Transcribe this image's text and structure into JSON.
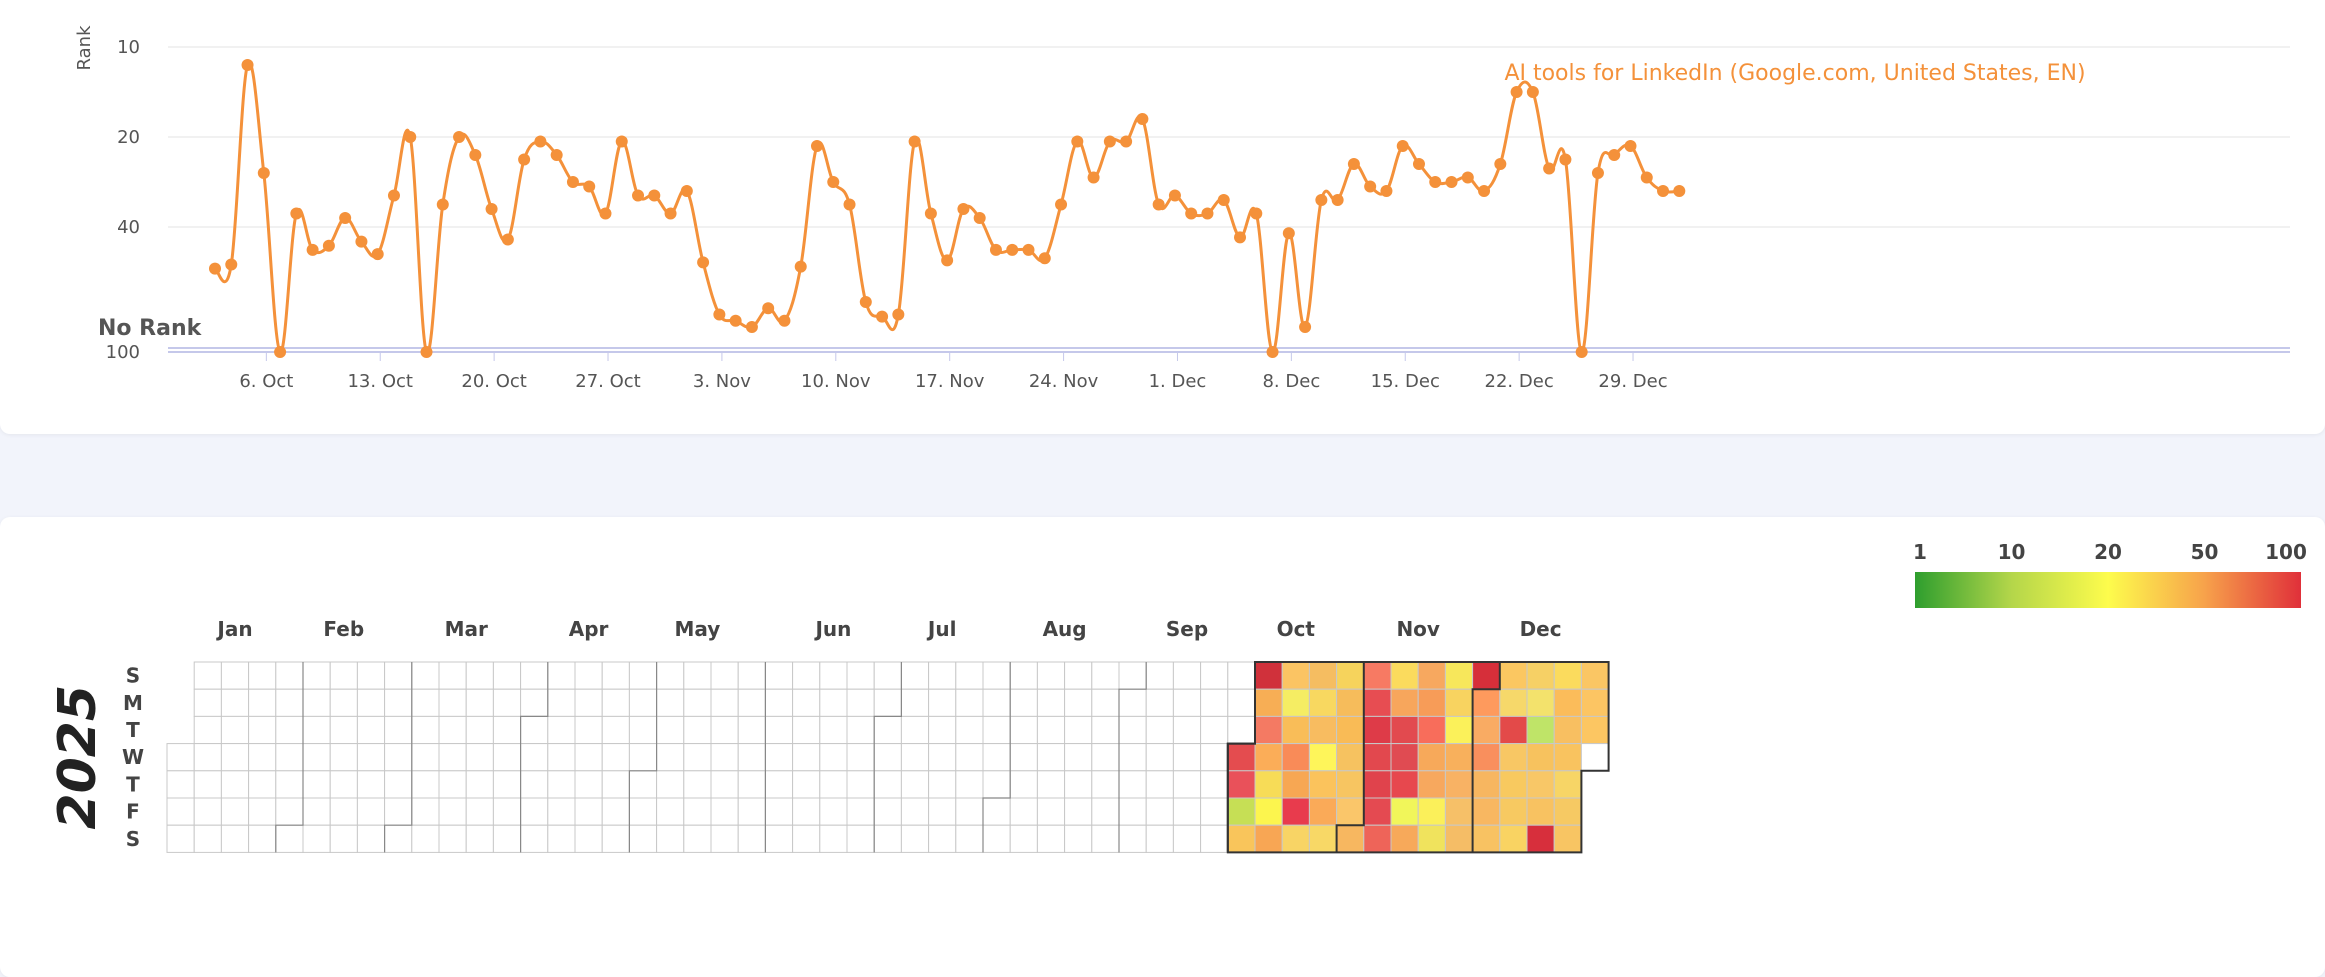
{
  "chart_data": [
    {
      "type": "line",
      "ylabel": "Rank",
      "y_ticks": [
        "10",
        "20",
        "40",
        "100"
      ],
      "y_axis_reversed": true,
      "no_rank_label": "No Rank",
      "x_ticks": [
        "6. Oct",
        "13. Oct",
        "20. Oct",
        "27. Oct",
        "3. Nov",
        "10. Nov",
        "17. Nov",
        "24. Nov",
        "1. Dec",
        "8. Dec",
        "15. Dec",
        "22. Dec",
        "29. Dec"
      ],
      "series": [
        {
          "name": "AI tools for LinkedIn (Google.com, United States, EN)",
          "color": "#f4913a",
          "start_date": "2025-10-01",
          "values": [
            60,
            58,
            12,
            28,
            100,
            37,
            51,
            49,
            38,
            47,
            53,
            33,
            20,
            100,
            35,
            20,
            24,
            36,
            46,
            25,
            21,
            24,
            30,
            31,
            37,
            21,
            33,
            33,
            37,
            32,
            57,
            82,
            85,
            88,
            79,
            85,
            59,
            22,
            30,
            35,
            76,
            83,
            82,
            21,
            37,
            56,
            36,
            38,
            51,
            51,
            51,
            55,
            35,
            21,
            29,
            21,
            21,
            18,
            35,
            33,
            37,
            37,
            34,
            45,
            37,
            100,
            43,
            88,
            34,
            34,
            26,
            31,
            32,
            22,
            26,
            30,
            30,
            29,
            32,
            26,
            15,
            15,
            27,
            25,
            100,
            28,
            24,
            22,
            29,
            32,
            32
          ],
          "null_values_plotted_as": "No Rank"
        }
      ]
    },
    {
      "type": "heatmap",
      "year": "2025",
      "months": [
        "Jan",
        "Feb",
        "Mar",
        "Apr",
        "May",
        "Jun",
        "Jul",
        "Aug",
        "Sep",
        "Oct",
        "Nov",
        "Dec"
      ],
      "weekdays": [
        "S",
        "M",
        "T",
        "W",
        "T",
        "F",
        "S"
      ],
      "color_scale": {
        "labels": [
          "1",
          "10",
          "20",
          "50",
          "100"
        ],
        "colors": [
          "#2e9e2e",
          "#b4d64a",
          "#fdfc4c",
          "#f7a24b",
          "#e0303a"
        ]
      },
      "first_ranked_date": "2025-10-01",
      "daily_colors": [
        "#e44c4f",
        "#e9515a",
        "#c6df55",
        "#f9c55b",
        "#d0313b",
        "#f7ae55",
        "#f47a63",
        "#fbad58",
        "#f7dc57",
        "#fcf54e",
        "#f8a654",
        "#fbc463",
        "#f5ed63",
        "#f9bd58",
        "#f98b58",
        "#f7a753",
        "#e83b4d",
        "#f8d465",
        "#f5bd61",
        "#f8d860",
        "#f8bc60",
        "#fef55a",
        "#fbc35c",
        "#faaa58",
        "#f8d866",
        "#f6d35c",
        "#f6bc5b",
        "#f9bb56",
        "#f6c260",
        "#f7c561",
        "#fac66a",
        "#f7b760",
        "#f77a63",
        "#e74d52",
        "#de3b48",
        "#e2484e",
        "#e0434c",
        "#e44a51",
        "#ee6459",
        "#fbdb5d",
        "#f7a65c",
        "#e24a4f",
        "#e04b52",
        "#e7484e",
        "#f1f65a",
        "#f7a95a",
        "#f7a85f",
        "#f79c58",
        "#f86d5b",
        "#f7a95a",
        "#f7a85e",
        "#fbf05a",
        "#f0e35d",
        "#f7e75b",
        "#f8d360",
        "#fbf15a",
        "#f8b05c",
        "#f8b264",
        "#f6c068",
        "#f5bd66",
        "#d62f3a",
        "#fe9a5d",
        "#f9ab63",
        "#f98f5d",
        "#f7b660",
        "#f8b761",
        "#f8c262",
        "#fbc761",
        "#f6d86a",
        "#e34a49",
        "#f8c764",
        "#f8c95f",
        "#f7c961",
        "#f9d362",
        "#f6d065",
        "#f3e26c",
        "#bfe468",
        "#f7c25e",
        "#f8c767",
        "#f8c261",
        "#d72f3c",
        "#fbdb5d",
        "#fbbc5a",
        "#f8bf61",
        "#f9c35f",
        "#f7d566",
        "#f6c963",
        "#f8c563",
        "#fac664",
        "#fcc563",
        "#fcc662",
        "#ffffff"
      ]
    }
  ]
}
